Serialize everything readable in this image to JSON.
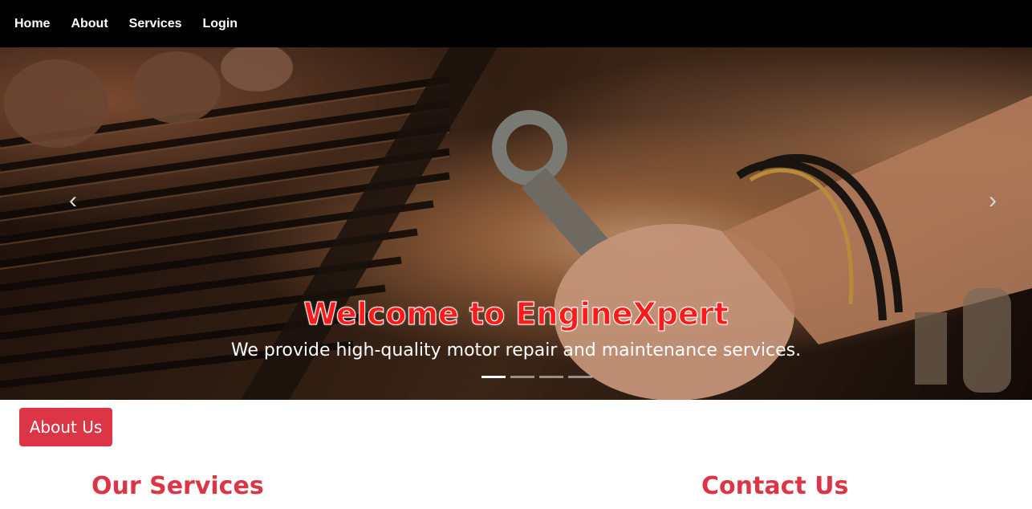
{
  "nav": {
    "items": [
      {
        "label": "Home"
      },
      {
        "label": "About"
      },
      {
        "label": "Services"
      },
      {
        "label": "Login"
      }
    ]
  },
  "carousel": {
    "title": "Welcome to EngineXpert",
    "subtitle": "We provide high-quality motor repair and maintenance services.",
    "prev_icon": "chevron-left-icon",
    "next_icon": "chevron-right-icon",
    "slide_count": 4,
    "active_slide": 1,
    "prev_glyph": "‹",
    "next_glyph": "›"
  },
  "about_button": {
    "label": "About Us"
  },
  "sections": {
    "services_heading": "Our Services",
    "contact_heading": "Contact Us"
  },
  "colors": {
    "accent": "#dc3545",
    "nav_bg": "#000000",
    "title_red": "#ff1a1a"
  }
}
